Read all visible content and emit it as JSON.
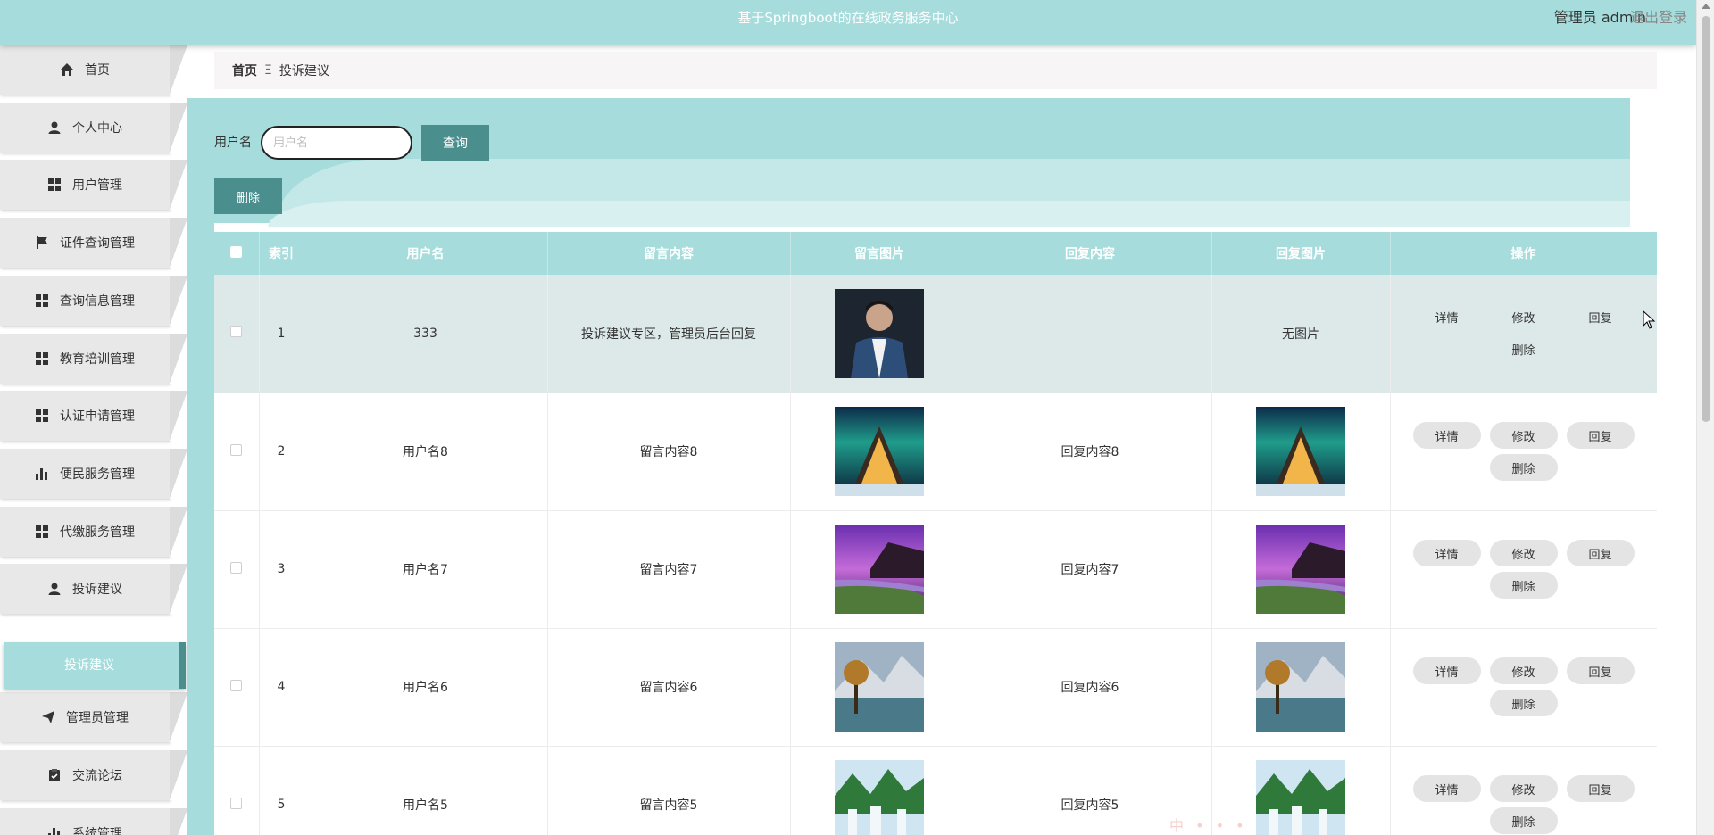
{
  "header": {
    "title": "基于Springboot的在线政务服务中心",
    "user": "管理员 admin",
    "logout": "退出登录"
  },
  "sidebar": {
    "items": [
      {
        "label": "首页",
        "icon": "home-icon"
      },
      {
        "label": "个人中心",
        "icon": "person-icon"
      },
      {
        "label": "用户管理",
        "icon": "grid-icon"
      },
      {
        "label": "证件查询管理",
        "icon": "flag-icon"
      },
      {
        "label": "查询信息管理",
        "icon": "grid-icon"
      },
      {
        "label": "教育培训管理",
        "icon": "grid-icon"
      },
      {
        "label": "认证申请管理",
        "icon": "grid-icon"
      },
      {
        "label": "便民服务管理",
        "icon": "bar-chart-icon"
      },
      {
        "label": "代缴服务管理",
        "icon": "grid-icon"
      },
      {
        "label": "投诉建议",
        "icon": "person-icon"
      },
      {
        "label": "管理员管理",
        "icon": "send-icon"
      },
      {
        "label": "交流论坛",
        "icon": "clipboard-icon"
      },
      {
        "label": "系统管理",
        "icon": "bar-chart-icon"
      }
    ],
    "active_sub": "投诉建议"
  },
  "breadcrumb": {
    "home": "首页",
    "separator": "Ξ",
    "current": "投诉建议"
  },
  "search": {
    "label": "用户名",
    "placeholder": "用户名",
    "button": "查询"
  },
  "actions": {
    "delete": "删除"
  },
  "table": {
    "headers": [
      "索引",
      "用户名",
      "留言内容",
      "留言图片",
      "回复内容",
      "回复图片",
      "操作"
    ],
    "op_labels": [
      "详情",
      "修改",
      "回复",
      "删除"
    ],
    "no_image": "无图片",
    "rows": [
      {
        "index": "1",
        "username": "333",
        "content": "投诉建议专区，管理员后台回复",
        "reply": "",
        "msg_img": "portrait",
        "reply_img": "none"
      },
      {
        "index": "2",
        "username": "用户名8",
        "content": "留言内容8",
        "reply": "回复内容8",
        "msg_img": "aurora",
        "reply_img": "aurora"
      },
      {
        "index": "3",
        "username": "用户名7",
        "content": "留言内容7",
        "reply": "回复内容7",
        "msg_img": "purple",
        "reply_img": "purple"
      },
      {
        "index": "4",
        "username": "用户名6",
        "content": "留言内容6",
        "reply": "回复内容6",
        "msg_img": "lake",
        "reply_img": "lake"
      },
      {
        "index": "5",
        "username": "用户名5",
        "content": "留言内容5",
        "reply": "回复内容5",
        "msg_img": "waterfall",
        "reply_img": "waterfall"
      }
    ]
  }
}
